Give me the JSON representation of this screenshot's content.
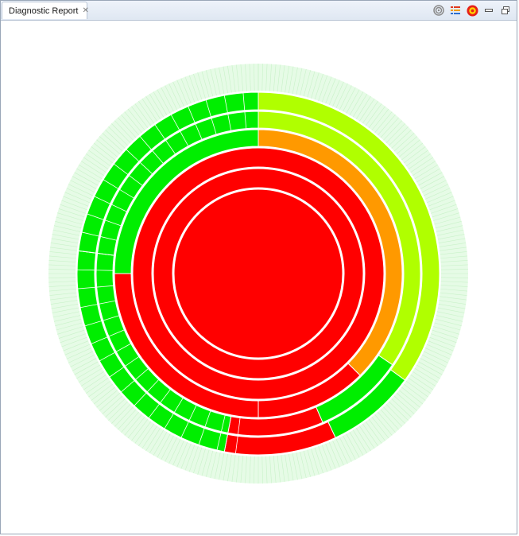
{
  "window": {
    "tab_title": "Diagnostic Report",
    "tab_icon": "diagnostic-report-icon",
    "close_icon": "close-icon"
  },
  "toolbar": {
    "items": [
      {
        "icon": "target-icon"
      },
      {
        "icon": "legend-list-icon"
      },
      {
        "icon": "settings-wheel-icon"
      },
      {
        "icon": "minimize-icon"
      },
      {
        "icon": "restore-icon"
      }
    ]
  },
  "colors": {
    "red": "#ff0000",
    "orange": "#ff9900",
    "yellow_green": "#b0ff00",
    "green": "#00ee00",
    "pale_green": "#e6fbe6",
    "separator": "#ffffff"
  },
  "chart_data": {
    "type": "sunburst",
    "rings": [
      {
        "level": 0,
        "segments": [
          {
            "share": 100,
            "status": "red"
          }
        ]
      },
      {
        "level": 1,
        "segments": [
          {
            "share": 100,
            "status": "red"
          }
        ]
      },
      {
        "level": 2,
        "segments": [
          {
            "share": 100,
            "status": "red"
          }
        ]
      },
      {
        "level": 3,
        "segments": [
          {
            "share": 37.5,
            "status": "orange"
          },
          {
            "share": 12.5,
            "status": "red"
          },
          {
            "share": 25,
            "status": "red"
          },
          {
            "share": 25,
            "status": "green"
          }
        ]
      },
      {
        "level": 4,
        "segments": [
          {
            "share": 34.5,
            "status": "yellow_green"
          },
          {
            "share": 9,
            "status": "green"
          },
          {
            "share": 9.5,
            "status": "red"
          },
          {
            "share": 24,
            "status": "green"
          },
          {
            "share": 23,
            "status": "green"
          }
        ]
      },
      {
        "level": 5,
        "segments": [
          {
            "share": 35,
            "status": "yellow_green"
          },
          {
            "share": 8,
            "status": "green"
          },
          {
            "share": 10,
            "status": "red"
          },
          {
            "share": 24,
            "status": "green"
          },
          {
            "share": 23,
            "status": "green"
          }
        ]
      }
    ]
  }
}
